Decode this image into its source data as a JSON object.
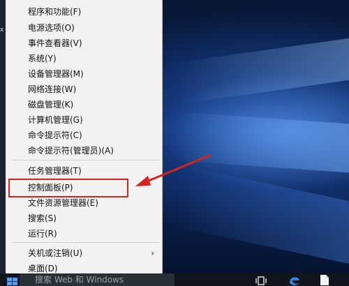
{
  "menu": {
    "items": [
      {
        "label": "程序和功能(F)",
        "name": "menu-item-programs-features"
      },
      {
        "label": "电源选项(O)",
        "name": "menu-item-power-options"
      },
      {
        "label": "事件查看器(V)",
        "name": "menu-item-event-viewer"
      },
      {
        "label": "系统(Y)",
        "name": "menu-item-system"
      },
      {
        "label": "设备管理器(M)",
        "name": "menu-item-device-manager"
      },
      {
        "label": "网络连接(W)",
        "name": "menu-item-network-connections"
      },
      {
        "label": "磁盘管理(K)",
        "name": "menu-item-disk-management"
      },
      {
        "label": "计算机管理(G)",
        "name": "menu-item-computer-management"
      },
      {
        "label": "命令提示符(C)",
        "name": "menu-item-command-prompt"
      },
      {
        "label": "命令提示符(管理员)(A)",
        "name": "menu-item-command-prompt-admin"
      },
      {
        "label": "任务管理器(T)",
        "name": "menu-item-task-manager"
      },
      {
        "label": "控制面板(P)",
        "name": "menu-item-control-panel"
      },
      {
        "label": "文件资源管理器(E)",
        "name": "menu-item-file-explorer"
      },
      {
        "label": "搜索(S)",
        "name": "menu-item-search"
      },
      {
        "label": "运行(R)",
        "name": "menu-item-run"
      },
      {
        "label": "关机或注销(U)",
        "name": "menu-item-shutdown-signout",
        "submenu_indicator": "›"
      },
      {
        "label": "桌面(D)",
        "name": "menu-item-desktop"
      }
    ]
  },
  "taskbar": {
    "search_placeholder": "搜索 Web 和 Windows"
  },
  "left_strip": {
    "close_glyph": "x"
  },
  "annotation": {
    "highlight_color": "#d6231c",
    "highlighted_item": "控制面板(P)"
  }
}
